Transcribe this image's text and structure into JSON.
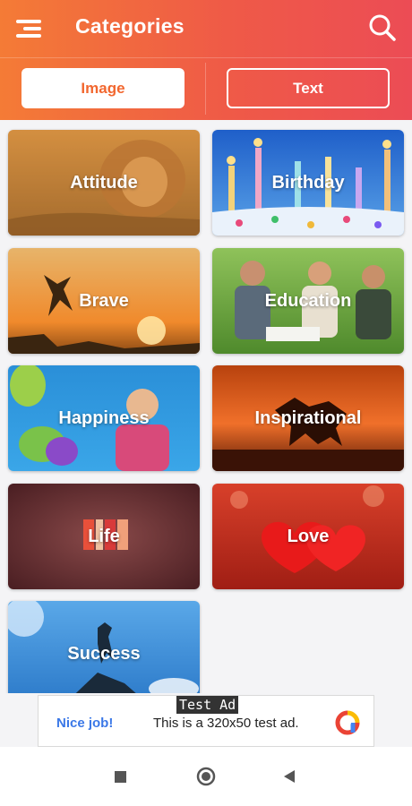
{
  "toolbar": {
    "title": "Categories",
    "menu_icon": "hamburger-menu-icon",
    "search_icon": "search-icon"
  },
  "tabs": [
    {
      "label": "Image",
      "selected": true
    },
    {
      "label": "Text",
      "selected": false
    }
  ],
  "categories": [
    {
      "label": "Attitude",
      "image": "lion"
    },
    {
      "label": "Birthday",
      "image": "birthday-candles"
    },
    {
      "label": "Brave",
      "image": "person-jumping-sunset"
    },
    {
      "label": "Education",
      "image": "students-studying"
    },
    {
      "label": "Happiness",
      "image": "girl-with-balloons"
    },
    {
      "label": "Inspirational",
      "image": "horse-silhouette-sunset"
    },
    {
      "label": "Life",
      "image": "life-typography"
    },
    {
      "label": "Love",
      "image": "red-hearts"
    },
    {
      "label": "Success",
      "image": "person-on-summit"
    }
  ],
  "ad": {
    "tag": "Test Ad",
    "cta": "Nice job!",
    "body": "This is a 320x50 test ad.",
    "logo_icon": "ad-network-logo-icon"
  },
  "nav": {
    "recents_icon": "square-recents-icon",
    "home_icon": "circle-home-icon",
    "back_icon": "triangle-back-icon"
  },
  "colors": {
    "toolbar_gradient_start": "#f47b36",
    "toolbar_gradient_end": "#ec4c55",
    "selected_tab_text": "#f2672f",
    "ad_cta": "#3b78e7"
  }
}
